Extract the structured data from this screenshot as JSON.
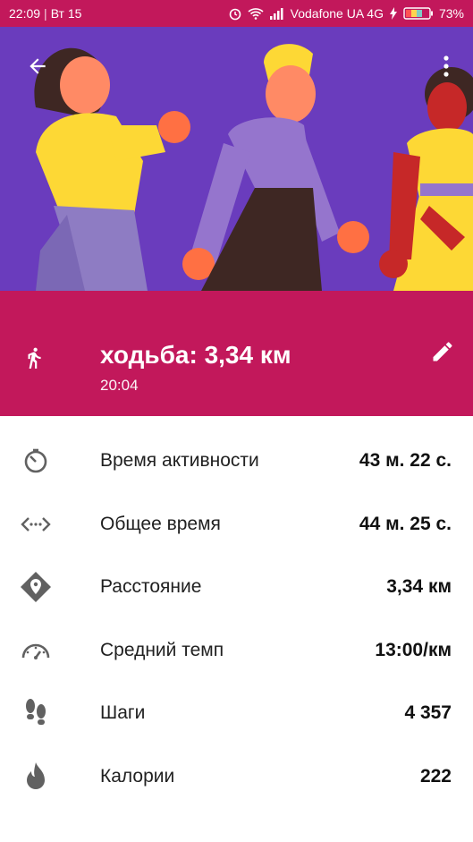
{
  "status_bar": {
    "time": "22:09",
    "separator": "|",
    "day": "Вт 15",
    "carrier": "Vodafone UA 4G",
    "battery": "73%"
  },
  "header": {
    "activity_title": "ходьба: 3,34 км",
    "activity_time": "20:04"
  },
  "stats": [
    {
      "icon": "timer-icon",
      "label": "Время активности",
      "value": "43 м. 22 с."
    },
    {
      "icon": "total-time-icon",
      "label": "Общее время",
      "value": "44 м. 25 с."
    },
    {
      "icon": "location-diamond-icon",
      "label": "Расстояние",
      "value": "3,34 км"
    },
    {
      "icon": "speedometer-icon",
      "label": "Средний темп",
      "value": "13:00/км"
    },
    {
      "icon": "footsteps-icon",
      "label": "Шаги",
      "value": "4 357"
    },
    {
      "icon": "fire-icon",
      "label": "Калории",
      "value": "222"
    }
  ],
  "colors": {
    "accent": "#c2185b",
    "hero_bg": "#6a3cbd"
  }
}
